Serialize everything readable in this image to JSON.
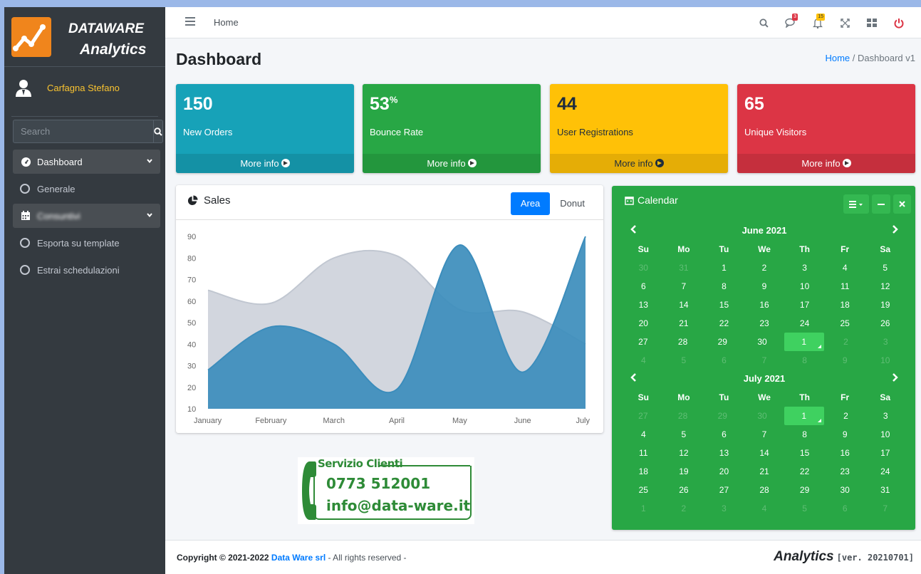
{
  "brand": {
    "line1": "DATAWARE",
    "line2": "Analytics"
  },
  "user": {
    "name": "Carfagna Stefano"
  },
  "search": {
    "placeholder": "Search",
    "icon": "search-icon"
  },
  "sidebar": {
    "items": [
      {
        "label": "Dashboard",
        "icon": "tachometer-icon",
        "active": true
      },
      {
        "label": "Generale",
        "icon": "circle-icon"
      },
      {
        "label": "Consuntivi",
        "icon": "calendar-icon"
      },
      {
        "label": "Esporta su template",
        "icon": "circle-icon"
      },
      {
        "label": "Estrai schedulazioni",
        "icon": "circle-icon"
      }
    ]
  },
  "topbar": {
    "home": "Home",
    "messages_badge": "3",
    "notifications_badge": "15",
    "icons": [
      "search-icon",
      "comments-icon",
      "bell-icon",
      "expand-icon",
      "grid-icon",
      "power-icon"
    ]
  },
  "page": {
    "title": "Dashboard",
    "breadcrumb_home": "Home",
    "breadcrumb_sep": "/",
    "breadcrumb_current": "Dashboard v1"
  },
  "boxes": [
    {
      "value": "150",
      "suffix": "",
      "label": "New Orders",
      "more": "More info",
      "color": "#17a2b8"
    },
    {
      "value": "53",
      "suffix": "%",
      "label": "Bounce Rate",
      "more": "More info",
      "color": "#28a745"
    },
    {
      "value": "44",
      "suffix": "",
      "label": "User Registrations",
      "more": "More info",
      "color": "#ffc107"
    },
    {
      "value": "65",
      "suffix": "",
      "label": "Unique Visitors",
      "more": "More info",
      "color": "#dc3545"
    }
  ],
  "sales": {
    "title": "Sales",
    "tab_area": "Area",
    "tab_donut": "Donut"
  },
  "chart_data": {
    "type": "area",
    "categories": [
      "January",
      "February",
      "March",
      "April",
      "May",
      "June",
      "July"
    ],
    "series": [
      {
        "values": [
          65,
          59,
          80,
          81,
          56,
          55,
          40
        ],
        "color": "#d2d6de"
      },
      {
        "values": [
          28,
          48,
          40,
          19,
          86,
          27,
          90
        ],
        "color": "#3c8dbc"
      }
    ],
    "ylim": [
      10,
      90
    ],
    "yticks": [
      10,
      20,
      30,
      40,
      50,
      60,
      70,
      80,
      90
    ]
  },
  "banner": {
    "title": "Servizio Clienti",
    "phone": "0773 512001",
    "email": "info@data-ware.it"
  },
  "calendar": {
    "title": "Calendar",
    "dows": [
      "Su",
      "Mo",
      "Tu",
      "We",
      "Th",
      "Fr",
      "Sa"
    ],
    "months": [
      {
        "title": "June 2021",
        "weeks": [
          [
            "30",
            "31",
            "1",
            "2",
            "3",
            "4",
            "5"
          ],
          [
            "6",
            "7",
            "8",
            "9",
            "10",
            "11",
            "12"
          ],
          [
            "13",
            "14",
            "15",
            "16",
            "17",
            "18",
            "19"
          ],
          [
            "20",
            "21",
            "22",
            "23",
            "24",
            "25",
            "26"
          ],
          [
            "27",
            "28",
            "29",
            "30",
            "1",
            "2",
            "3"
          ],
          [
            "4",
            "5",
            "6",
            "7",
            "8",
            "9",
            "10"
          ]
        ]
      },
      {
        "title": "July 2021",
        "weeks": [
          [
            "27",
            "28",
            "29",
            "30",
            "1",
            "2",
            "3"
          ],
          [
            "4",
            "5",
            "6",
            "7",
            "8",
            "9",
            "10"
          ],
          [
            "11",
            "12",
            "13",
            "14",
            "15",
            "16",
            "17"
          ],
          [
            "18",
            "19",
            "20",
            "21",
            "22",
            "23",
            "24"
          ],
          [
            "25",
            "26",
            "27",
            "28",
            "29",
            "30",
            "31"
          ],
          [
            "1",
            "2",
            "3",
            "4",
            "5",
            "6",
            "7"
          ]
        ]
      }
    ]
  },
  "footer": {
    "copyright": "Copyright © 2021-2022",
    "company": "Data Ware srl",
    "rights": "- All rights reserved -",
    "app": "Analytics",
    "version": "[ver. 20210701]"
  }
}
